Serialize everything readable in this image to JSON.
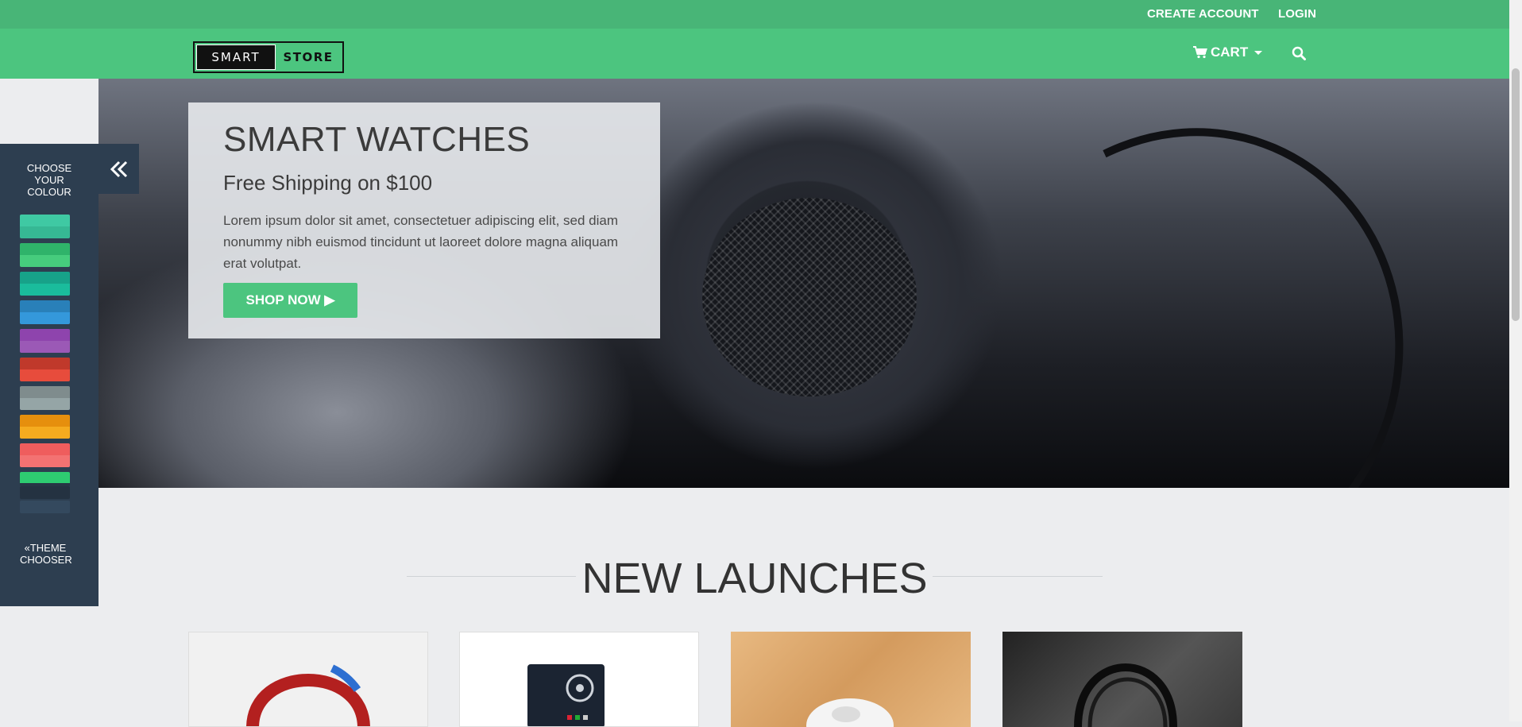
{
  "topbar": {
    "create_account": "CREATE ACCOUNT",
    "login": "LOGIN"
  },
  "brand": {
    "logo_left": "SMART",
    "logo_right": "STORE"
  },
  "nav": {
    "cart_label": "CART",
    "cart_icon": "shopping-cart-icon",
    "search_icon": "search-icon"
  },
  "hero": {
    "title": "SMART WATCHES",
    "subtitle": "Free Shipping on $100",
    "body": "Lorem ipsum dolor sit amet, consectetuer adipiscing elit, sed diam nonummy nibh euismod tincidunt ut laoreet dolore magna aliquam erat volutpat.",
    "cta": "SHOP NOW ▶"
  },
  "chooser": {
    "title": "CHOOSE YOUR COLOUR",
    "toggle_icon": "double-chevron-left-icon",
    "footer": "«THEME CHOOSER",
    "swatches": [
      {
        "name": "turquoise",
        "top": "#3fc9a3",
        "bottom": "#36b894"
      },
      {
        "name": "emerald",
        "top": "#2fb36a",
        "bottom": "#46cc7d"
      },
      {
        "name": "green-sea",
        "top": "#17a289",
        "bottom": "#1abc9c"
      },
      {
        "name": "blue",
        "top": "#2980b9",
        "bottom": "#3498db"
      },
      {
        "name": "purple",
        "top": "#8e44ad",
        "bottom": "#9b59b6"
      },
      {
        "name": "red",
        "top": "#c0392b",
        "bottom": "#e74c3c"
      },
      {
        "name": "grey",
        "top": "#7f8c8d",
        "bottom": "#95a5a6"
      },
      {
        "name": "orange",
        "top": "#e68f0d",
        "bottom": "#f5ab1f"
      },
      {
        "name": "salmon",
        "top": "#ef5d5d",
        "bottom": "#f37272"
      },
      {
        "name": "midnight",
        "top": "#2ecc71",
        "bottom": "#273645"
      },
      {
        "name": "slate",
        "top": "#243241",
        "bottom": "#2c3e50"
      },
      {
        "name": "navy",
        "top": "#34495e",
        "bottom": "#34495e"
      }
    ]
  },
  "section": {
    "title": "NEW LAUNCHES"
  },
  "colors": {
    "primary": "#4cc57f",
    "topbar": "#48b577",
    "chooser_bg": "#2d3e50"
  }
}
